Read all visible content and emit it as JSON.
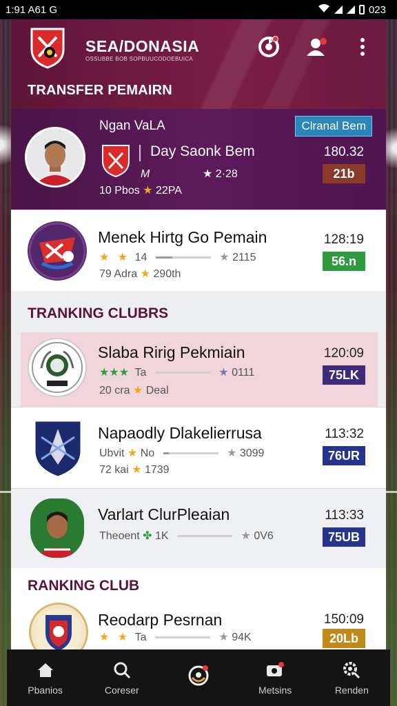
{
  "status_bar": {
    "time": "1:91 A61 G",
    "battery": "023"
  },
  "header": {
    "title": "SEA/DONASIA",
    "subtitle": "OSSUBBE BOB SOPBUUCODOEBUICA",
    "section_title": "TRANSFER PEMAIRN"
  },
  "featured": {
    "name": "Ngan VaLA",
    "action_label": "Clranal Bem",
    "club_name": "Day Saonk Bem",
    "meta_left": "M",
    "rating": "2·28",
    "footer_left": "10 Pbos",
    "footer_right": "22PA",
    "time": "180.32",
    "badge": "21b",
    "badge_color": "#8a3a2a"
  },
  "transfer_rows": [
    {
      "name": "Menek Hirtg Go Pemain",
      "stat_left": "14",
      "stat_right": "2115",
      "footer_left": "79 Adra",
      "footer_right": "290th",
      "time": "128:19",
      "badge": "56.n",
      "badge_color": "#2f9a3e"
    }
  ],
  "section_ranking_clubs": "TRANKING CLUBRS",
  "ranking_rows": [
    {
      "name": "Slaba Ririg Pekmiain",
      "stat_left": "Ta",
      "stat_right": "0111",
      "footer_left": "20 cra",
      "footer_right": "Deal",
      "time": "120:09",
      "badge": "75LK",
      "badge_color": "#3f2a7a"
    },
    {
      "name": "Napaodly Dlakelierrusa",
      "stat_prefix": "Ubvit",
      "stat_left": "No",
      "stat_right": "3099",
      "footer_left": "72 kai",
      "footer_right": "1739",
      "time": "113:32",
      "badge": "76UR",
      "badge_color": "#27348f"
    },
    {
      "name": "Varlart ClurPleaian",
      "stat_prefix": "Theoent",
      "stat_left": "1K",
      "stat_right": "0V6",
      "time": "113:33",
      "badge": "75UB",
      "badge_color": "#27348f"
    }
  ],
  "section_ranking_club": "RANKING CLUB",
  "last_row": {
    "name": "Reodarp Pesrnan",
    "stat_left": "Ta",
    "stat_right": "94K",
    "time": "150:09",
    "badge": "20Lb",
    "badge_color": "#c08a1a"
  },
  "bottom_nav": [
    {
      "label": "Pbanios",
      "icon": "home-icon"
    },
    {
      "label": "Coreser",
      "icon": "search-icon"
    },
    {
      "label": "",
      "icon": "refresh-icon"
    },
    {
      "label": "Metsins",
      "icon": "inbox-icon"
    },
    {
      "label": "Renden",
      "icon": "search-settings-icon"
    }
  ]
}
